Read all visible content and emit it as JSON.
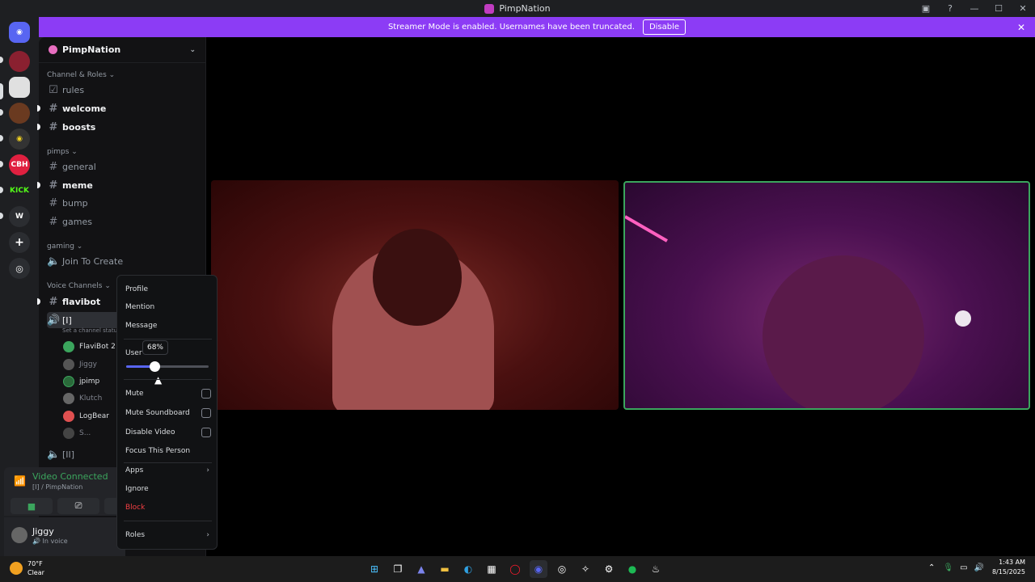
{
  "titlebar": {
    "title": "PimpNation"
  },
  "banner": {
    "message": "Streamer Mode is enabled. Usernames have been truncated.",
    "button": "Disable"
  },
  "guild": {
    "name": "PimpNation"
  },
  "channels": {
    "cat1": "Channel & Roles",
    "rules": "rules",
    "welcome": "welcome",
    "boosts": "boosts",
    "cat2": "pimps",
    "general": "general",
    "meme": "meme",
    "bump": "bump",
    "games": "games",
    "cat3": "gaming",
    "join": "Join To Create",
    "cat4": "Voice Channels",
    "flavibot": "flavibot",
    "voice1": "[I]",
    "voice1_status": "Set a channel status",
    "voice2": "[II]"
  },
  "voice_users": [
    "FlaviBot 2",
    "Jiggy",
    "jpimp",
    "Klutch",
    "LogBear",
    "S..."
  ],
  "voice_panel": {
    "status": "Video Connected",
    "channel": "[I] / PimpNation"
  },
  "user_panel": {
    "name": "Jiggy",
    "status": "In voice"
  },
  "context_menu": {
    "profile": "Profile",
    "mention": "Mention",
    "message": "Message",
    "user_volume": "User",
    "volume_value": 0.68,
    "volume_label": "68%",
    "mute": "Mute",
    "mute_soundboard": "Mute Soundboard",
    "disable_video": "Disable Video",
    "focus": "Focus This Person",
    "apps": "Apps",
    "ignore": "Ignore",
    "block": "Block",
    "roles": "Roles"
  },
  "taskbar": {
    "temp": "70°F",
    "weather": "Clear",
    "time": "1:43 AM",
    "date": "8/15/2025"
  },
  "servers": [
    "CBH",
    "KICK"
  ]
}
